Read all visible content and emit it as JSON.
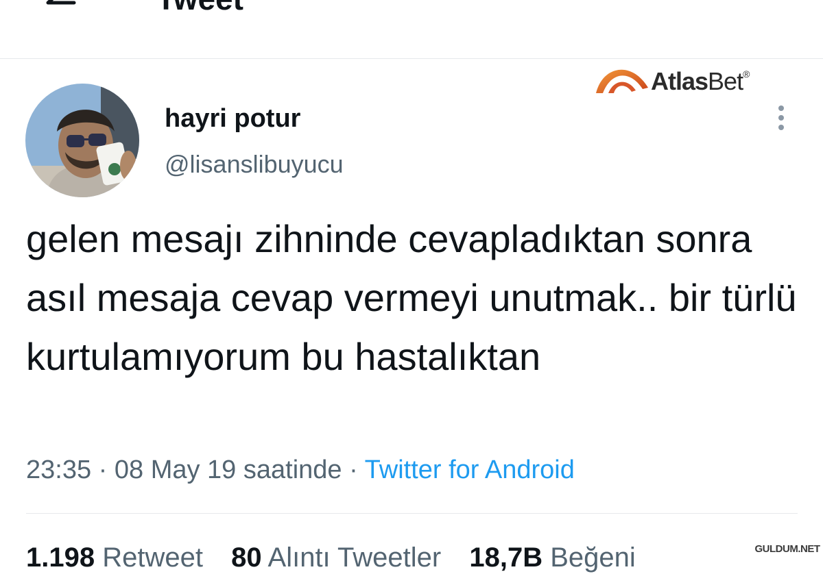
{
  "header": {
    "title": "Tweet",
    "back_icon": "arrow-left-icon"
  },
  "watermark": {
    "brand_bold": "Atlas",
    "brand_light": "Bet",
    "registered": "®"
  },
  "tweet": {
    "author_name": "hayri potur",
    "author_handle": "@lisanslibuyucu",
    "text": "gelen mesajı zihninde cevapladıktan sonra asıl mesaja cevap vermeyi unutmak.. bir türlü kurtulamıyorum bu hastalıktan",
    "time": "23:35",
    "date": "08 May 19 saatinde",
    "separator": "·",
    "source": "Twitter for Android"
  },
  "stats": {
    "retweets": "1.198",
    "retweets_label": "Retweet",
    "quotes": "80",
    "quotes_label": "Alıntı Tweetler",
    "likes": "18,7B",
    "likes_label": "Beğeni"
  },
  "footer_watermark": "GULDUM.NET",
  "colors": {
    "link": "#1d9bf0",
    "secondary": "#536471",
    "text": "#0f1419",
    "brand_orange": "#e8742a"
  }
}
